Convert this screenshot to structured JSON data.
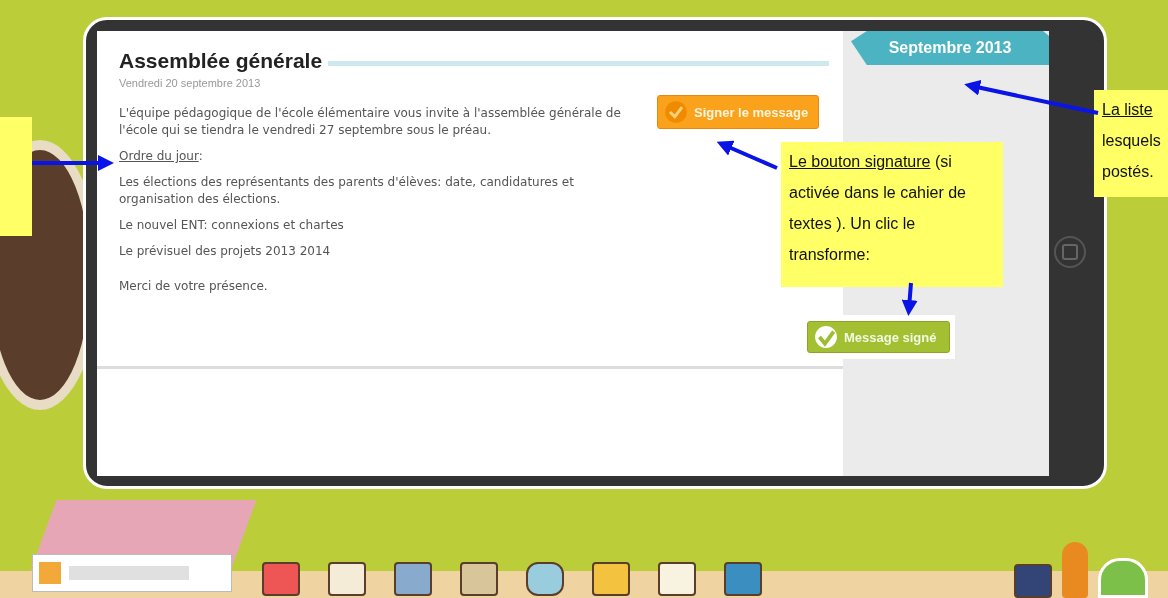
{
  "message": {
    "title": "Assemblée générale",
    "date": "Vendredi 20 septembre 2013",
    "paragraphs": [
      {
        "kind": "text",
        "text": "L'équipe pédagogique de l'école élémentaire vous invite à l'assemblée générale de l'école qui se tiendra le vendredi 27 septembre sous le préau."
      },
      {
        "kind": "heading",
        "text": "Ordre du jour",
        "suffix": ":"
      },
      {
        "kind": "text",
        "text": "Les élections des représentants des parents d'élèves: date, candidatures et organisation des élections."
      },
      {
        "kind": "text",
        "text": "Le nouvel ENT: connexions et chartes"
      },
      {
        "kind": "text",
        "text": "Le prévisuel des projets 2013 2014"
      },
      {
        "kind": "closing",
        "text": "Merci de votre présence."
      }
    ]
  },
  "sign_button": {
    "label": "Signer le message"
  },
  "month_tab": {
    "label": "Septembre 2013"
  },
  "signed_button": {
    "label": "Message signé"
  },
  "callouts": [
    {
      "kind": "left"
    },
    {
      "kind": "middle",
      "underlined": "Le bouton signature",
      "rest": " (si activée dans le cahier de textes ). Un clic le transforme:"
    },
    {
      "kind": "right",
      "underlined": "La liste",
      "lines": [
        "lesquels",
        "postés."
      ]
    }
  ]
}
